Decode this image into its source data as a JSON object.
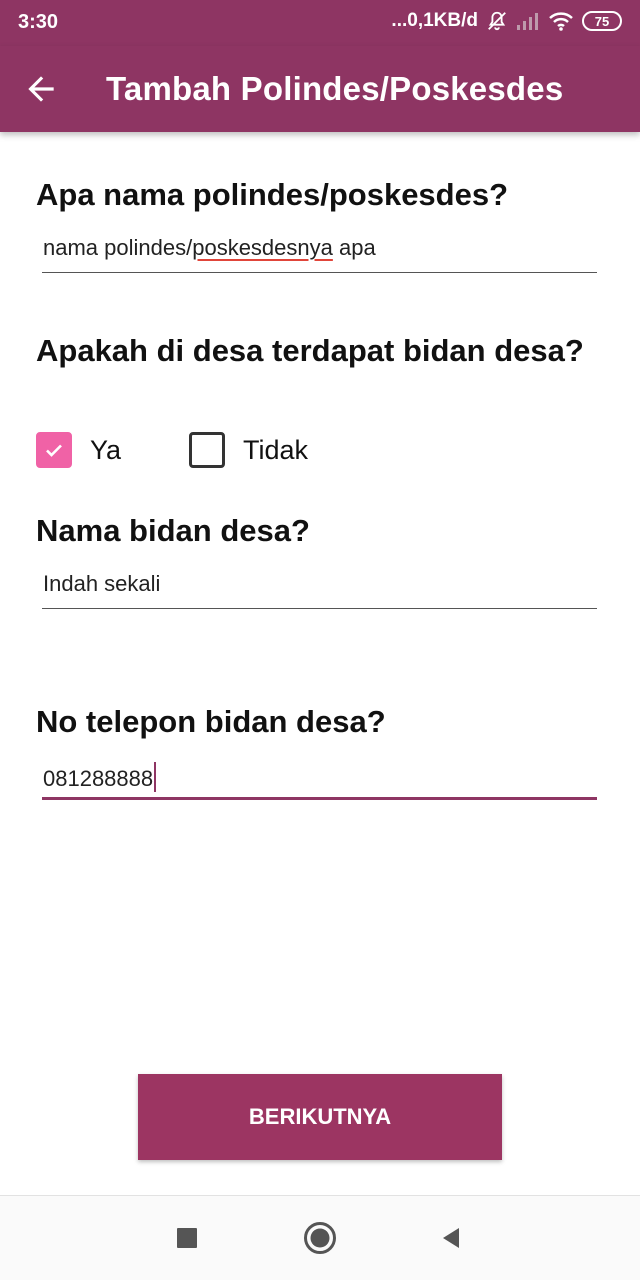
{
  "status_bar": {
    "time": "3:30",
    "network_speed": "...0,1KB/d",
    "battery_level": "75",
    "icons": [
      "mute-icon",
      "signal-icon",
      "wifi-icon",
      "battery-icon"
    ]
  },
  "app_bar": {
    "title": "Tambah Polindes/Poskesdes",
    "back_icon": "arrow-back-icon"
  },
  "form": {
    "q1": {
      "label": "Apa nama polindes/poskesdes?",
      "value_before": "nama polindes/",
      "value_misspelled": "poskesdesnya",
      "value_after": " apa"
    },
    "q2": {
      "label": "Apakah di desa terdapat bidan desa?",
      "options": [
        {
          "label": "Ya",
          "checked": true
        },
        {
          "label": "Tidak",
          "checked": false
        }
      ]
    },
    "q3": {
      "label": "Nama bidan desa?",
      "value": "Indah sekali"
    },
    "q4": {
      "label": "No telepon bidan desa?",
      "value": "081288888"
    }
  },
  "next_button": {
    "label": "BERIKUTNYA"
  },
  "nav_bar": {
    "icons": [
      "recent-apps-icon",
      "home-icon",
      "back-triangle-icon"
    ]
  },
  "colors": {
    "primary": "#8e3563",
    "button": "#9c3562",
    "checkbox_checked": "#f062a6",
    "spell_error": "#e0453a"
  }
}
